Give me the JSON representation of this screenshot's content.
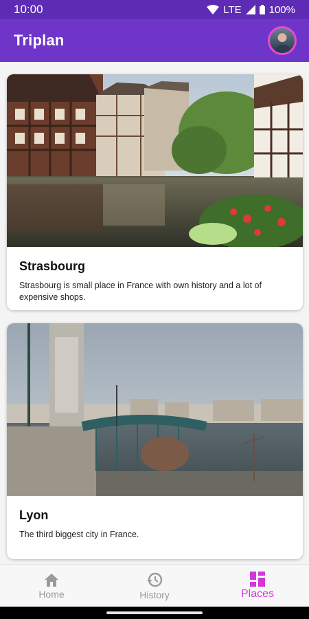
{
  "status_bar": {
    "time": "10:00",
    "network": "LTE",
    "battery": "100%"
  },
  "app_bar": {
    "title": "Triplan",
    "avatar_icon": "user-avatar"
  },
  "places": [
    {
      "title": "Strasbourg",
      "description": "Strasbourg is small place in France with own history and a lot of expensive shops."
    },
    {
      "title": "Lyon",
      "description": "The third biggest city in France."
    }
  ],
  "bottom_nav": [
    {
      "label": "Home",
      "icon": "home-icon",
      "active": false
    },
    {
      "label": "History",
      "icon": "history-icon",
      "active": false
    },
    {
      "label": "Places",
      "icon": "places-grid-icon",
      "active": true
    }
  ],
  "colors": {
    "status_bar": "#5e2bb5",
    "app_bar": "#6f35c8",
    "accent": "#d237d9"
  }
}
